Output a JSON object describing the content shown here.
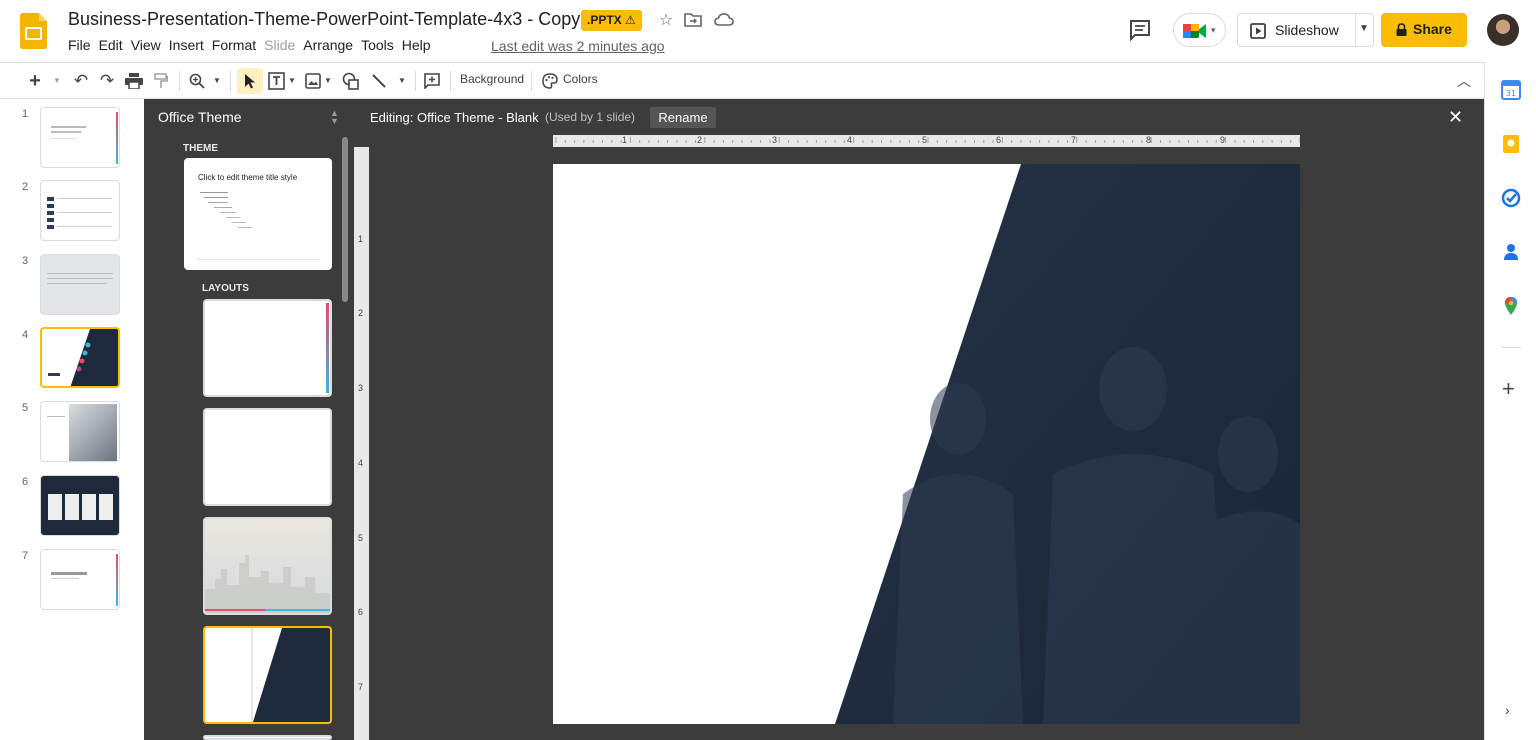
{
  "app": {
    "title": "Business-Presentation-Theme-PowerPoint-Template-4x3 - Copy",
    "format_badge": ".PPTX ⚠",
    "last_edit": "Last edit was 2 minutes ago"
  },
  "menu": [
    "File",
    "Edit",
    "View",
    "Insert",
    "Format",
    "Slide",
    "Arrange",
    "Tools",
    "Help"
  ],
  "header_actions": {
    "slideshow_label": "Slideshow",
    "share_label": "Share",
    "accent_color": "#fbbc04"
  },
  "toolbar": {
    "background_label": "Background",
    "colors_label": "Colors"
  },
  "filmstrip": {
    "numbers": [
      "1",
      "2",
      "3",
      "4",
      "5",
      "6",
      "7"
    ],
    "selected": 4
  },
  "theme_panel": {
    "title": "Office Theme",
    "theme_heading": "THEME",
    "layouts_heading": "LAYOUTS",
    "master_title": "Click to edit theme title style"
  },
  "editor": {
    "title": "Editing: Office Theme - Blank",
    "used": "(Used by 1 slide)",
    "rename_label": "Rename",
    "ruler_h": [
      "1",
      "2",
      "3",
      "4",
      "5",
      "6",
      "7",
      "8",
      "9"
    ],
    "ruler_v": [
      "1",
      "2",
      "3",
      "4",
      "5",
      "6",
      "7"
    ],
    "shape_color": "#1e2a3b"
  }
}
